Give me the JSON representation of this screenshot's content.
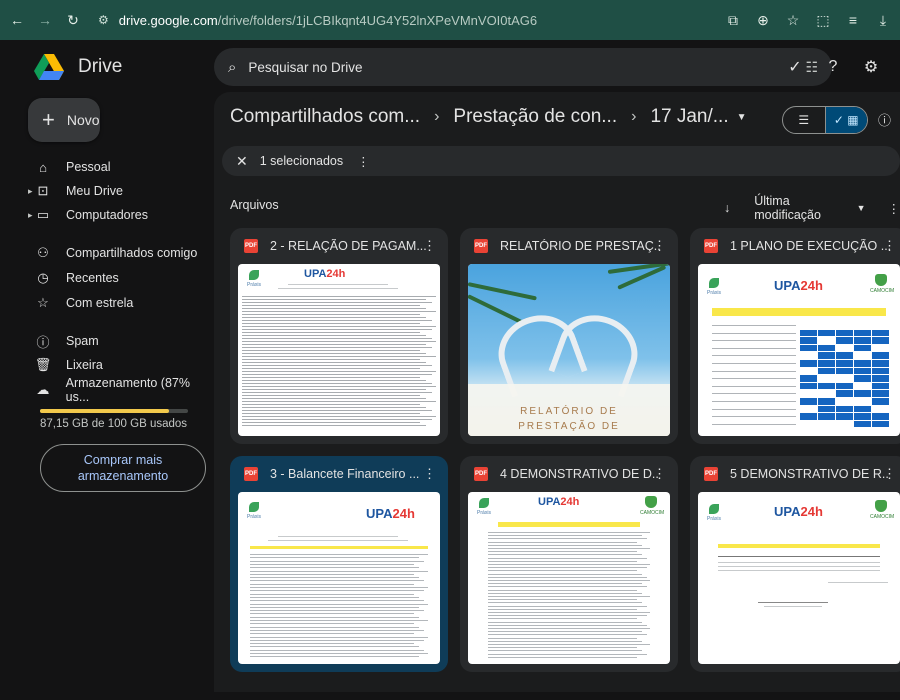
{
  "browser": {
    "url_host": "drive.google.com",
    "url_path": "/drive/folders/1jLCBIkqnt4UG4Y52lnXPeVMnVOI0tAG6"
  },
  "app": {
    "name": "Drive"
  },
  "new_button": {
    "label": "Novo"
  },
  "sidebar": {
    "items": [
      {
        "label": "Pessoal",
        "icon": "home-icon"
      },
      {
        "label": "Meu Drive",
        "icon": "my-drive-icon"
      },
      {
        "label": "Computadores",
        "icon": "computer-icon"
      },
      {
        "label": "Compartilhados comigo",
        "icon": "people-icon"
      },
      {
        "label": "Recentes",
        "icon": "clock-icon"
      },
      {
        "label": "Com estrela",
        "icon": "star-icon"
      },
      {
        "label": "Spam",
        "icon": "spam-icon"
      },
      {
        "label": "Lixeira",
        "icon": "trash-icon"
      },
      {
        "label": "Armazenamento (87% us...",
        "icon": "cloud-icon"
      }
    ],
    "storage_used_fraction": 0.87,
    "storage_text": "87,15 GB de 100 GB usados",
    "buy_storage_line1": "Comprar mais",
    "buy_storage_line2": "armazenamento"
  },
  "search": {
    "placeholder": "Pesquisar no Drive"
  },
  "breadcrumb": {
    "items": [
      "Compartilhados com...",
      "Prestação de con...",
      "17 Jan/..."
    ]
  },
  "selection": {
    "text": "1 selecionados"
  },
  "files": {
    "section_label": "Arquivos",
    "sort_label": "Última modificação"
  },
  "cards": [
    {
      "title": "2 - RELAÇÃO DE PAGAM...",
      "selected": false
    },
    {
      "title": "RELATÓRIO DE PRESTAÇ...",
      "selected": false
    },
    {
      "title": "1 PLANO DE EXECUÇÃO ...",
      "selected": false
    },
    {
      "title": "3 - Balancete Financeiro ...",
      "selected": true
    },
    {
      "title": "4 DEMONSTRATIVO DE D...",
      "selected": false
    },
    {
      "title": "5 DEMONSTRATIVO DE R...",
      "selected": false
    }
  ],
  "thumbnail_text": {
    "logo_left": "Práxis",
    "logo_center_a": "UPA",
    "logo_center_b": "24h",
    "logo_right": "CAMOCIM",
    "report_line1": "RELATÓRIO DE",
    "report_line2": "PRESTAÇÃO DE"
  },
  "colors": {
    "accent": "#a8c7fa",
    "selected_card": "#0f3c58",
    "pdf_red": "#ea4335",
    "storage_fill": "#f2c94c"
  }
}
